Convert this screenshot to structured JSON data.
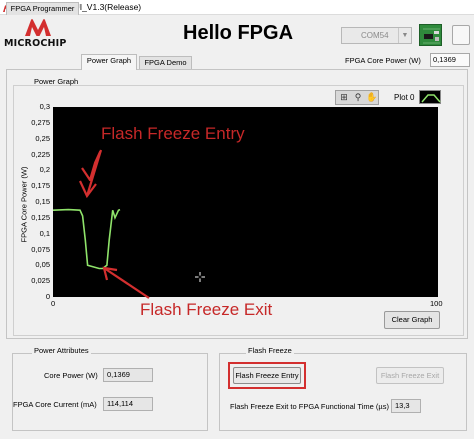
{
  "window": {
    "title": "Hello_FPGA_GUI_V1.3(Release)"
  },
  "brand": {
    "logo_text": "MICROCHIP"
  },
  "header": {
    "title": "Hello FPGA"
  },
  "connection": {
    "com_port": "COM54"
  },
  "tabs": [
    {
      "label": "FPGA Programmer",
      "active": false
    },
    {
      "label": "Power Graph",
      "active": true
    },
    {
      "label": "FPGA Demo",
      "active": false
    }
  ],
  "core_power_top": {
    "label": "FPGA Core Power (W)",
    "value": "0,1369"
  },
  "graph": {
    "section_label": "Power Graph",
    "plot_label": "Plot 0",
    "clear_label": "Clear Graph"
  },
  "chart_data": {
    "type": "line",
    "ylabel": "FPGA Core Power (W)",
    "xlim": [
      0,
      100
    ],
    "ylim": [
      0,
      0.3
    ],
    "x_ticks": [
      "0",
      "100"
    ],
    "y_ticks": [
      "0",
      "0,025",
      "0,05",
      "0,075",
      "0,1",
      "0,125",
      "0,15",
      "0,175",
      "0,2",
      "0,225",
      "0,25",
      "0,275",
      "0,3"
    ],
    "series": [
      {
        "color": "#8fe36a",
        "x": [
          0,
          4,
          7,
          7.7,
          8.4,
          9,
          12,
          13,
          13.5,
          14,
          14.6,
          15.5,
          16.1,
          17,
          17.4
        ],
        "y": [
          0.137,
          0.138,
          0.137,
          0.128,
          0.09,
          0.05,
          0.045,
          0.045,
          0.048,
          0.05,
          0.09,
          0.137,
          0.125,
          0.137,
          0.138
        ]
      }
    ],
    "grid": false
  },
  "annotations": {
    "entry_text": "Flash Freeze Entry",
    "exit_text": "Flash Freeze Exit",
    "color": "#c62828"
  },
  "power_attributes": {
    "title": "Power Attributes",
    "core_power_label": "Core Power (W)",
    "core_power_value": "0,1369",
    "core_current_label": "FPGA Core Current (mA)",
    "core_current_value": "114,114"
  },
  "flash_freeze": {
    "title": "Flash Freeze",
    "entry_label": "Flash Freeze Entry",
    "exit_label": "Flash Freeze Exit",
    "exit_time_label": "Flash Freeze Exit to FPGA Functional Time (µs)",
    "exit_time_value": "13,3"
  }
}
